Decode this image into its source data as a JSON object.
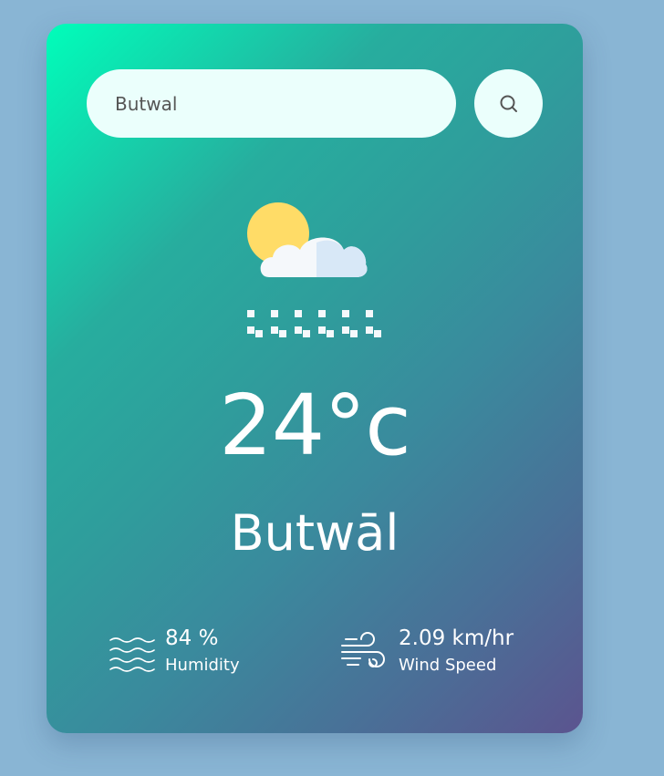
{
  "search": {
    "value": "Butwal",
    "button_icon": "search-icon"
  },
  "weather": {
    "icon": "snow-cloud-sun-icon",
    "temperature": "24°c",
    "city": "Butwāl"
  },
  "details": {
    "humidity": {
      "icon": "waves-icon",
      "value": "84 %",
      "label": "Humidity"
    },
    "wind": {
      "icon": "wind-icon",
      "value": "2.09 km/hr",
      "label": "Wind Speed"
    }
  },
  "colors": {
    "page_background": "#89b5d4",
    "card_gradient_start": "#00feba",
    "card_gradient_end": "#5b548f",
    "input_background": "#ebfffc",
    "text": "#ffffff"
  }
}
